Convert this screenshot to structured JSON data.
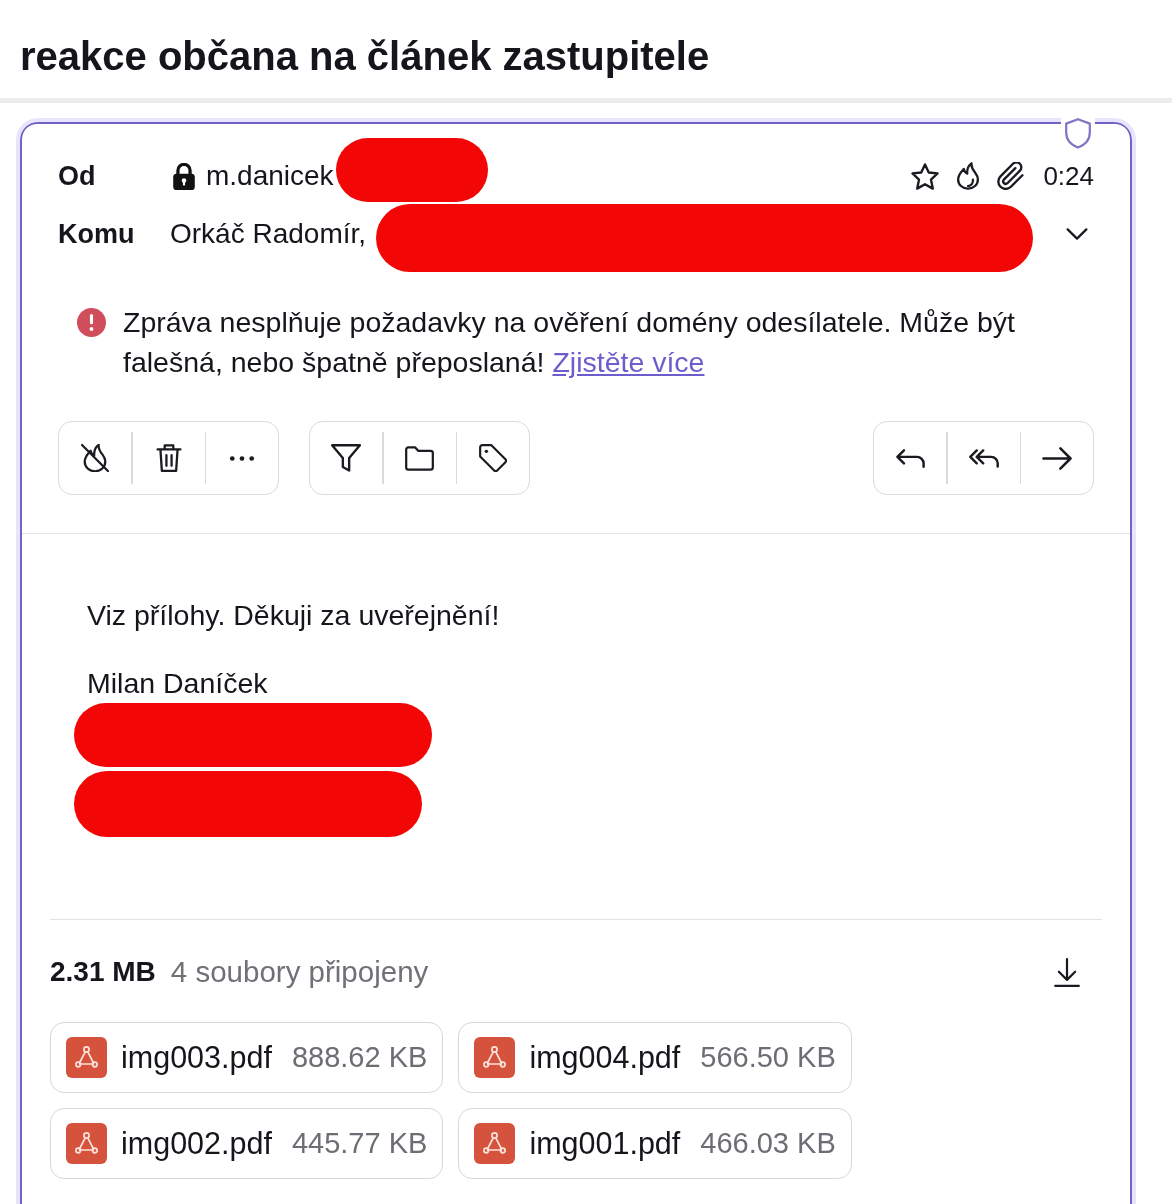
{
  "page_title": "reakce občana na článek zastupitele",
  "message": {
    "from": {
      "label": "Od",
      "address": "m.danicek",
      "redacted": true
    },
    "to": {
      "label": "Komu",
      "recipients": "Orkáč Radomír,",
      "redacted": true
    },
    "details": {
      "expanded": false
    },
    "time": "0:24",
    "warning": {
      "text": "Zpráva nesplňuje požadavky na ověření domény odesílatele. Může být falešná, nebo špatně přeposlaná!",
      "link": "Zjistěte více"
    },
    "body": [
      {
        "kind": "text",
        "text": "Viz přílohy. Děkuji za uveřejnění!"
      },
      {
        "kind": "text",
        "text": "Milan Daníček"
      },
      {
        "kind": "redacted"
      },
      {
        "kind": "redacted"
      }
    ]
  },
  "attachments": {
    "total_size": "2.31 MB",
    "summary": "4 soubory připojeny",
    "files": [
      {
        "name": "img003.pdf",
        "size": "888.62 KB"
      },
      {
        "name": "img004.pdf",
        "size": "566.50 KB"
      },
      {
        "name": "img002.pdf",
        "size": "445.77 KB"
      },
      {
        "name": "img001.pdf",
        "size": "466.03 KB"
      }
    ]
  }
}
